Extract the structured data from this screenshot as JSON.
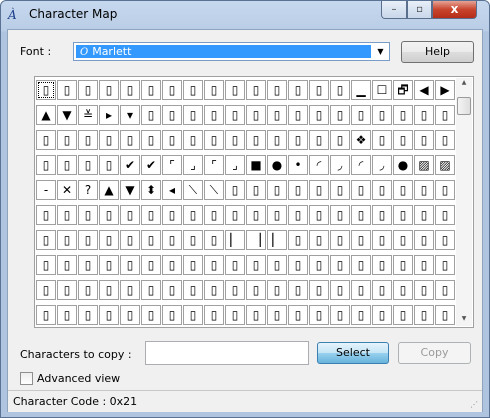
{
  "window": {
    "title": "Character Map",
    "app_icon": "À",
    "minimize": "–",
    "maximize": "▫",
    "close": "x"
  },
  "font": {
    "label": "Font :",
    "selected": "Marlett",
    "selected_icon": "O",
    "dropdown_arrow": "▼"
  },
  "help_label": "Help",
  "grid": {
    "columns": 20,
    "rows": 10,
    "selected_index": 0,
    "cells": [
      "▯",
      "▯",
      "▯",
      "▯",
      "▯",
      "▯",
      "▯",
      "▯",
      "▯",
      "▯",
      "▯",
      "▯",
      "▯",
      "▯",
      "▯",
      "▁",
      "☐",
      "🗗",
      "◀",
      "▶",
      "▲",
      "▼",
      "≚",
      "▸",
      "▾",
      "▯",
      "▯",
      "▯",
      "▯",
      "▯",
      "▯",
      "▯",
      "▯",
      "▯",
      "▯",
      "▯",
      "▯",
      "▯",
      "▯",
      "▯",
      "▯",
      "▯",
      "▯",
      "▯",
      "▯",
      "▯",
      "▯",
      "▯",
      "▯",
      "▯",
      "▯",
      "▯",
      "▯",
      "▯",
      "▯",
      "❖",
      "▯",
      "▯",
      "▯",
      "▯",
      "▯",
      "▯",
      "▯",
      "▯",
      "✔",
      "✔",
      "⌜",
      "⌟",
      "⌜",
      "⌟",
      "■",
      "●",
      "•",
      "◜",
      "◞",
      "◜",
      "◞",
      "●",
      "▨",
      "▨",
      "‐",
      "✕",
      "?",
      "▲",
      "▼",
      "⬍",
      "◂",
      "⟍",
      "⟍",
      "▯",
      "▯",
      "▯",
      "▯",
      "▯",
      "▯",
      "▯",
      "▯",
      "▯",
      "▯",
      "▯",
      "▯",
      "▯",
      "▯",
      "▯",
      "▯",
      "▯",
      "▯",
      "▯",
      "▯",
      "▯",
      "▯",
      "▯",
      "▯",
      "▯",
      "▯",
      "▯",
      "▯",
      "▯",
      "▯",
      "▯",
      "▯",
      "▯",
      "▯",
      "▯",
      "▯",
      "▯",
      "▯",
      "▯",
      "▯",
      "▏",
      "▕",
      "▏",
      "▯",
      "▯",
      "▯",
      "▯",
      "▯",
      "▯",
      "▯",
      "▯",
      "▯",
      "▯",
      "▯",
      "▯",
      "▯",
      "▯",
      "▯",
      "▯",
      "▯",
      "▯",
      "▯",
      "▯",
      "▯",
      "▯",
      "▯",
      "▯",
      "▯",
      "▯",
      "▯",
      "▯",
      "▯",
      "▯",
      "▯",
      "▯",
      "▯",
      "▯",
      "▯",
      "▯",
      "▯",
      "▯",
      "▯",
      "▯",
      "▯",
      "▯",
      "▯",
      "▯",
      "▯",
      "▯",
      "▯",
      "▯",
      "▯",
      "▯",
      "▯",
      "▯",
      "▯",
      "▯",
      "▯",
      "▯",
      "▯",
      "▯",
      "▯",
      "▯",
      "▯",
      "▯",
      "▯",
      "▯",
      "▯",
      "▯",
      "▯",
      "▯"
    ]
  },
  "scrollbar": {
    "up_arrow": "▲",
    "down_arrow": "▼"
  },
  "copy": {
    "label": "Characters to copy :",
    "value": "",
    "select_label": "Select",
    "copy_label": "Copy"
  },
  "advanced": {
    "label": "Advanced view",
    "checked": false
  },
  "status": {
    "text": "Character Code : 0x21",
    "grip": "⋰"
  }
}
